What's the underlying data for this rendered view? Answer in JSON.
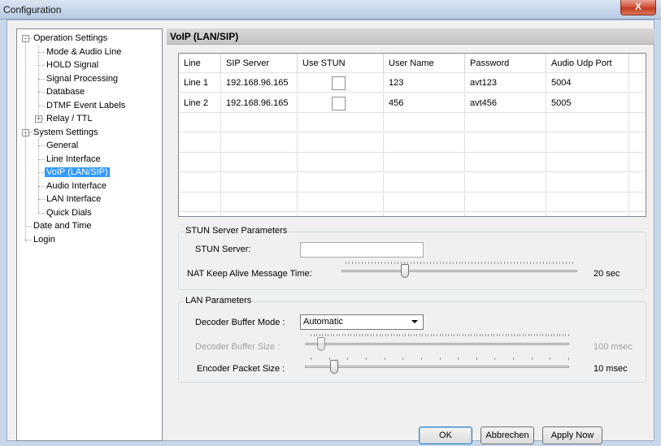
{
  "window": {
    "title": "Configuration",
    "close_glyph": "X"
  },
  "tree": {
    "items": [
      {
        "label": "Operation Settings",
        "level": 0,
        "expander": "-"
      },
      {
        "label": "Mode & Audio Line",
        "level": 1
      },
      {
        "label": "HOLD Signal",
        "level": 1
      },
      {
        "label": "Signal Processing",
        "level": 1
      },
      {
        "label": "Database",
        "level": 1
      },
      {
        "label": "DTMF Event Labels",
        "level": 1
      },
      {
        "label": "Relay / TTL",
        "level": 1,
        "expander": "+"
      },
      {
        "label": "System Settings",
        "level": 0,
        "expander": "-"
      },
      {
        "label": "General",
        "level": 1
      },
      {
        "label": "Line Interface",
        "level": 1
      },
      {
        "label": "VoIP (LAN/SIP)",
        "level": 1,
        "selected": true
      },
      {
        "label": "Audio Interface",
        "level": 1
      },
      {
        "label": "LAN Interface",
        "level": 1
      },
      {
        "label": "Quick Dials",
        "level": 1
      },
      {
        "label": "Date and Time",
        "level": 0
      },
      {
        "label": "Login",
        "level": 0
      }
    ]
  },
  "panel": {
    "header": "VoIP (LAN/SIP)"
  },
  "grid": {
    "columns": [
      "Line",
      "SIP Server",
      "Use STUN",
      "User Name",
      "Password",
      "Audio Udp Port"
    ],
    "rows": [
      {
        "line": "Line 1",
        "sip_server": "192.168.96.165",
        "use_stun": false,
        "user_name": "123",
        "password": "avt123",
        "port": "5004"
      },
      {
        "line": "Line 2",
        "sip_server": "192.168.96.165",
        "use_stun": false,
        "user_name": "456",
        "password": "avt456",
        "port": "5005"
      }
    ]
  },
  "stun": {
    "group_title": "STUN Server Parameters",
    "server_label": "STUN Server:",
    "server_value": "",
    "nat_label": "NAT Keep Alive Message Time:",
    "nat_value_text": "20 sec",
    "nat_fraction": 0.27
  },
  "lan": {
    "group_title": "LAN Parameters",
    "decoder_mode_label": "Decoder Buffer Mode :",
    "decoder_mode_value": "Automatic",
    "decoder_size_label": "Decoder Buffer Size :",
    "decoder_size_value_text": "100 msec",
    "decoder_size_fraction": 0.06,
    "encoder_label": "Encoder Packet Size :",
    "encoder_value_text": "10 msec",
    "encoder_fraction": 0.11
  },
  "buttons": {
    "ok": "OK",
    "cancel": "Abbrechen",
    "apply": "Apply Now"
  }
}
